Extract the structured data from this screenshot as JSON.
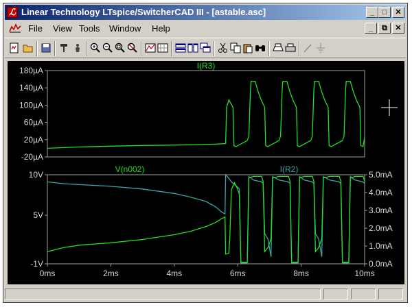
{
  "window": {
    "title": "Linear Technology LTspice/SwitcherCAD III - [astable.asc]",
    "app_icon_glyph": "ℒ",
    "min_glyph": "_",
    "max_glyph": "□",
    "close_glyph": "✕",
    "restore_glyph": "⧉"
  },
  "menu": {
    "items": [
      {
        "label": "File"
      },
      {
        "label": "View"
      },
      {
        "label": "Tools"
      },
      {
        "label": "Window"
      },
      {
        "label": "Help"
      }
    ]
  },
  "toolbar": {
    "icons": [
      "new-schematic-icon",
      "open-icon",
      "save-icon",
      "run-icon",
      "halt-icon",
      "zoom-in-icon",
      "zoom-out-icon",
      "zoom-fit-icon",
      "zoom-cancel-icon",
      "autorange-icon",
      "grid-icon",
      "tile-horizontal-icon",
      "tile-vertical-icon",
      "cascade-icon",
      "cut-icon",
      "copy-icon",
      "paste-icon",
      "find-icon",
      "print-preview-icon",
      "print-icon",
      "draw-line-icon",
      "ground-icon"
    ]
  },
  "colors": {
    "green": "#22e022",
    "cyan": "#3aa6a6",
    "axis": "#a0a0a0",
    "label": "#d8d8d8",
    "background": "#000000"
  },
  "chart_data": [
    {
      "type": "line",
      "title": "I(R3)",
      "y_ticks": [
        "180µA",
        "140µA",
        "100µA",
        "60µA",
        "20µA",
        "-20µA"
      ],
      "ylim": [
        -20,
        180
      ],
      "y_unit": "µA",
      "xlim": [
        0,
        10
      ],
      "x_unit": "ms",
      "series": [
        {
          "name": "I(R3)",
          "color": "#22e022",
          "points": [
            [
              0,
              0
            ],
            [
              1,
              3
            ],
            [
              2,
              5
            ],
            [
              3,
              6.5
            ],
            [
              4,
              7.5
            ],
            [
              4.8,
              8.5
            ],
            [
              5.3,
              9.5
            ],
            [
              5.5,
              10.5
            ],
            [
              5.62,
              11
            ],
            [
              5.65,
              95
            ],
            [
              5.72,
              112
            ],
            [
              5.85,
              95
            ],
            [
              5.88,
              6
            ],
            [
              5.95,
              4
            ],
            [
              6.1,
              10
            ],
            [
              6.3,
              18
            ],
            [
              6.35,
              28
            ],
            [
              6.4,
              135
            ],
            [
              6.42,
              155
            ],
            [
              6.55,
              155
            ],
            [
              6.65,
              130
            ],
            [
              6.75,
              110
            ],
            [
              6.85,
              95
            ],
            [
              6.88,
              6
            ],
            [
              6.95,
              4
            ],
            [
              7.1,
              10
            ],
            [
              7.3,
              18
            ],
            [
              7.35,
              28
            ],
            [
              7.4,
              135
            ],
            [
              7.42,
              155
            ],
            [
              7.55,
              155
            ],
            [
              7.65,
              130
            ],
            [
              7.75,
              110
            ],
            [
              7.85,
              95
            ],
            [
              7.88,
              6
            ],
            [
              7.95,
              4
            ],
            [
              8.1,
              10
            ],
            [
              8.3,
              18
            ],
            [
              8.35,
              28
            ],
            [
              8.4,
              135
            ],
            [
              8.42,
              155
            ],
            [
              8.55,
              155
            ],
            [
              8.65,
              130
            ],
            [
              8.75,
              110
            ],
            [
              8.85,
              95
            ],
            [
              8.88,
              6
            ],
            [
              8.95,
              4
            ],
            [
              9.1,
              10
            ],
            [
              9.3,
              18
            ],
            [
              9.35,
              28
            ],
            [
              9.4,
              135
            ],
            [
              9.42,
              155
            ],
            [
              9.55,
              155
            ],
            [
              9.65,
              130
            ],
            [
              9.75,
              110
            ],
            [
              9.85,
              95
            ],
            [
              9.88,
              6
            ],
            [
              9.95,
              4
            ],
            [
              10,
              25
            ]
          ]
        }
      ]
    },
    {
      "type": "line",
      "series_labels": [
        "V(n002)",
        "I(R2)"
      ],
      "y_ticks_left": [
        "10V",
        "5V",
        "-1V"
      ],
      "ylim_left": [
        -1,
        10
      ],
      "y_ticks_right": [
        "5.0mA",
        "4.0mA",
        "3.0mA",
        "2.0mA",
        "1.0mA",
        "0.0mA"
      ],
      "ylim_right": [
        0,
        5
      ],
      "x_ticks": [
        "0ms",
        "2ms",
        "4ms",
        "6ms",
        "8ms",
        "10ms"
      ],
      "xlim": [
        0,
        10
      ],
      "series": [
        {
          "name": "V(n002)",
          "axis": "left",
          "color": "#22e022",
          "points": [
            [
              0,
              0.5
            ],
            [
              0.5,
              1
            ],
            [
              1,
              1.3
            ],
            [
              2,
              1.6
            ],
            [
              3,
              2
            ],
            [
              4,
              2.6
            ],
            [
              4.5,
              3
            ],
            [
              5,
              3.6
            ],
            [
              5.3,
              4.1
            ],
            [
              5.5,
              4.6
            ],
            [
              5.6,
              4.8
            ],
            [
              5.62,
              0.2
            ],
            [
              5.72,
              0.3
            ],
            [
              5.75,
              2
            ],
            [
              5.8,
              8.2
            ],
            [
              5.9,
              9
            ],
            [
              6.0,
              8.2
            ],
            [
              6.05,
              7.6
            ],
            [
              6.1,
              -0.8
            ],
            [
              6.3,
              -0.8
            ],
            [
              6.35,
              9.6
            ],
            [
              6.5,
              9.8
            ],
            [
              6.75,
              9.8
            ],
            [
              6.8,
              9.2
            ],
            [
              6.85,
              0.5
            ],
            [
              6.95,
              1
            ],
            [
              7.05,
              2.1
            ],
            [
              7.1,
              9.6
            ],
            [
              7.3,
              9.8
            ],
            [
              7.6,
              9.8
            ],
            [
              7.65,
              9.2
            ],
            [
              7.7,
              -0.8
            ],
            [
              7.9,
              -0.8
            ],
            [
              7.95,
              9.6
            ],
            [
              8.1,
              9.8
            ],
            [
              8.35,
              9.8
            ],
            [
              8.4,
              9.2
            ],
            [
              8.45,
              0.5
            ],
            [
              8.55,
              1
            ],
            [
              8.65,
              2.1
            ],
            [
              8.7,
              9.6
            ],
            [
              8.9,
              9.8
            ],
            [
              9.2,
              9.8
            ],
            [
              9.25,
              9.2
            ],
            [
              9.3,
              -0.8
            ],
            [
              9.5,
              -0.8
            ],
            [
              9.55,
              9.6
            ],
            [
              9.7,
              9.8
            ],
            [
              9.95,
              9.8
            ],
            [
              10,
              9.2
            ]
          ]
        },
        {
          "name": "I(R2)",
          "axis": "right",
          "color": "#3aa6a6",
          "points": [
            [
              0,
              4.6
            ],
            [
              0.5,
              4.5
            ],
            [
              1,
              4.45
            ],
            [
              2,
              4.35
            ],
            [
              3,
              4.2
            ],
            [
              4,
              3.95
            ],
            [
              4.5,
              3.75
            ],
            [
              5,
              3.5
            ],
            [
              5.3,
              3.2
            ],
            [
              5.5,
              2.9
            ],
            [
              5.6,
              2.8
            ],
            [
              5.62,
              5
            ],
            [
              5.7,
              4.85
            ],
            [
              5.8,
              4.6
            ],
            [
              5.9,
              4.45
            ],
            [
              6.0,
              4.3
            ],
            [
              6.05,
              4.2
            ],
            [
              6.1,
              0.05
            ],
            [
              6.3,
              0.05
            ],
            [
              6.35,
              4.9
            ],
            [
              6.5,
              4.7
            ],
            [
              6.75,
              4.6
            ],
            [
              6.8,
              4.5
            ],
            [
              6.85,
              1.7
            ],
            [
              6.95,
              1.4
            ],
            [
              7.05,
              0.4
            ],
            [
              7.1,
              4.9
            ],
            [
              7.3,
              4.7
            ],
            [
              7.6,
              4.6
            ],
            [
              7.65,
              4.5
            ],
            [
              7.7,
              0.05
            ],
            [
              7.9,
              0.05
            ],
            [
              7.95,
              4.9
            ],
            [
              8.1,
              4.7
            ],
            [
              8.35,
              4.6
            ],
            [
              8.4,
              4.5
            ],
            [
              8.45,
              1.7
            ],
            [
              8.55,
              1.4
            ],
            [
              8.65,
              0.4
            ],
            [
              8.7,
              4.9
            ],
            [
              8.9,
              4.7
            ],
            [
              9.2,
              4.6
            ],
            [
              9.25,
              4.5
            ],
            [
              9.3,
              0.05
            ],
            [
              9.5,
              0.05
            ],
            [
              9.55,
              4.9
            ],
            [
              9.7,
              4.7
            ],
            [
              9.95,
              4.6
            ],
            [
              10,
              4.5
            ]
          ]
        }
      ]
    }
  ]
}
